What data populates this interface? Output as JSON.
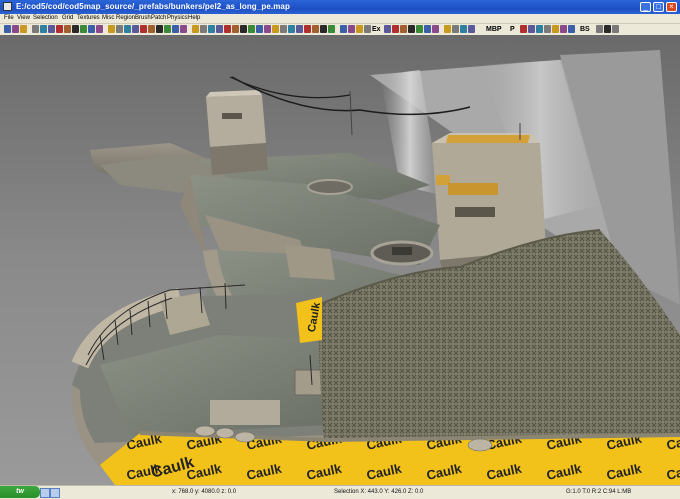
{
  "window": {
    "title": "E:/cod5/cod/cod5map_source/_prefabs/bunkers/pel2_as_long_pe.map",
    "min_label": "_",
    "max_label": "□",
    "close_label": "×"
  },
  "menu": {
    "items": [
      "File",
      "View",
      "Selection",
      "Grid",
      "Textures",
      "Misc",
      "Region",
      "Brush",
      "Patch",
      "Physics",
      "Help"
    ]
  },
  "toolbar": {
    "text_buttons": [
      "Ex",
      "MBP",
      "P",
      "BS"
    ]
  },
  "viewport": {
    "caulk_label": "Caulk",
    "caulk_label_sign": "Caulk"
  },
  "statusbar": {
    "start_label": "tw",
    "coords": "x: 768.0  y: 4080.0  z: 0.0",
    "selection": "Selection X: 443.0  Y: 426.0  Z: 0.0",
    "grid": "G:1.0  T:0  R:2  C:94  L:MB"
  },
  "colors": {
    "titlebar": "#1d4fc2",
    "menubar": "#ece9d8",
    "caulk": "#f2c21a",
    "sky": "#7d7d7d"
  }
}
